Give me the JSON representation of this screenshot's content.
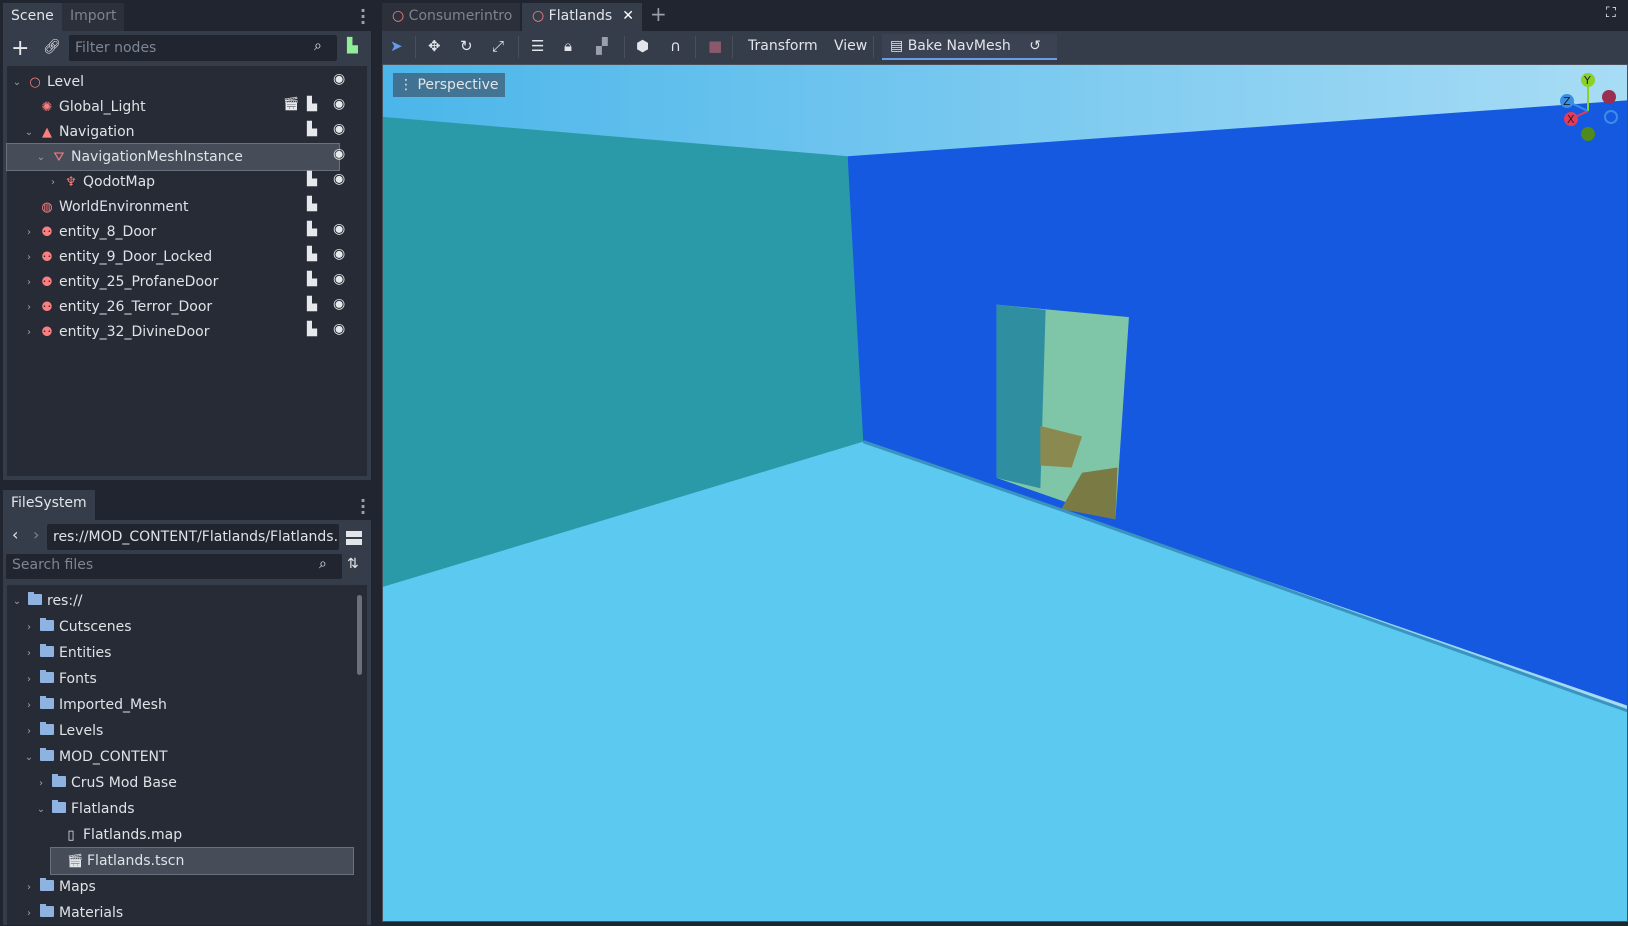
{
  "scene_dock": {
    "tabs": [
      "Scene",
      "Import"
    ],
    "filter_placeholder": "Filter nodes",
    "nodes": [
      {
        "label": "Level",
        "icon": "node3d-icon",
        "color": "#fc7f7f",
        "depth": 0,
        "expanded": true,
        "script": false,
        "visible": true
      },
      {
        "label": "Global_Light",
        "icon": "light-icon",
        "color": "#fc7f7f",
        "depth": 1,
        "extras": [
          "clapper-icon",
          "script-icon"
        ],
        "visible": true
      },
      {
        "label": "Navigation",
        "icon": "navigation-icon",
        "color": "#fc7f7f",
        "depth": 1,
        "expanded": true,
        "extras": [
          "script-icon"
        ],
        "visible": true
      },
      {
        "label": "NavigationMeshInstance",
        "icon": "navmesh-icon",
        "color": "#fc7f7f",
        "depth": 2,
        "expanded": true,
        "selected": true,
        "visible": true
      },
      {
        "label": "QodotMap",
        "icon": "qodot-icon",
        "color": "#fc7f7f",
        "depth": 3,
        "collapsed": true,
        "extras": [
          "script-icon"
        ],
        "visible": true
      },
      {
        "label": "WorldEnvironment",
        "icon": "world-icon",
        "color": "#fc7f7f",
        "depth": 1,
        "extras": [
          "script-icon"
        ]
      },
      {
        "label": "entity_8_Door",
        "icon": "kinematic-icon",
        "color": "#fc7f7f",
        "depth": 1,
        "collapsed": true,
        "extras": [
          "script-icon"
        ],
        "visible": true
      },
      {
        "label": "entity_9_Door_Locked",
        "icon": "kinematic-icon",
        "color": "#fc7f7f",
        "depth": 1,
        "collapsed": true,
        "extras": [
          "script-icon"
        ],
        "visible": true
      },
      {
        "label": "entity_25_ProfaneDoor",
        "icon": "kinematic-icon",
        "color": "#fc7f7f",
        "depth": 1,
        "collapsed": true,
        "extras": [
          "script-icon"
        ],
        "visible": true
      },
      {
        "label": "entity_26_Terror_Door",
        "icon": "kinematic-icon",
        "color": "#fc7f7f",
        "depth": 1,
        "collapsed": true,
        "extras": [
          "script-icon"
        ],
        "visible": true
      },
      {
        "label": "entity_32_DivineDoor",
        "icon": "kinematic-icon",
        "color": "#fc7f7f",
        "depth": 1,
        "collapsed": true,
        "extras": [
          "script-icon"
        ],
        "visible": true
      }
    ]
  },
  "filesystem": {
    "tab": "FileSystem",
    "path": "res://MOD_CONTENT/Flatlands/Flatlands.",
    "search_placeholder": "Search files",
    "items": [
      {
        "label": "res://",
        "type": "folder",
        "depth": 0,
        "expanded": true
      },
      {
        "label": "Cutscenes",
        "type": "folder",
        "depth": 1
      },
      {
        "label": "Entities",
        "type": "folder",
        "depth": 1
      },
      {
        "label": "Fonts",
        "type": "folder",
        "depth": 1
      },
      {
        "label": "Imported_Mesh",
        "type": "folder",
        "depth": 1
      },
      {
        "label": "Levels",
        "type": "folder",
        "depth": 1
      },
      {
        "label": "MOD_CONTENT",
        "type": "folder",
        "depth": 1,
        "expanded": true
      },
      {
        "label": "CruS Mod Base",
        "type": "folder",
        "depth": 2
      },
      {
        "label": "Flatlands",
        "type": "folder",
        "depth": 2,
        "expanded": true
      },
      {
        "label": "Flatlands.map",
        "type": "file",
        "depth": 3
      },
      {
        "label": "Flatlands.tscn",
        "type": "scene",
        "depth": 3,
        "selected": true
      },
      {
        "label": "Maps",
        "type": "folder",
        "depth": 1
      },
      {
        "label": "Materials",
        "type": "folder",
        "depth": 1
      }
    ]
  },
  "editor": {
    "scene_tabs": [
      "Consumerintro",
      "Flatlands"
    ],
    "active_tab": "Flatlands",
    "toolbar": {
      "transform": "Transform",
      "view": "View",
      "bake": "Bake NavMesh"
    },
    "viewport": {
      "mode": "Perspective",
      "gizmo": {
        "y": "Y",
        "z": "Z",
        "x": "X"
      }
    },
    "colors": {
      "accent": "#699ce8",
      "node": "#fc7f7f"
    }
  }
}
